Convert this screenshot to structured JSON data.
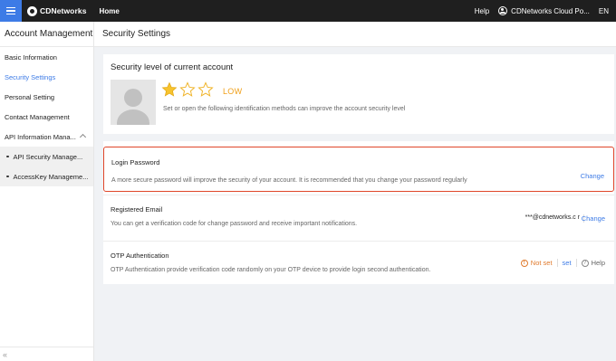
{
  "topbar": {
    "brand": "CDNetworks",
    "nav_home": "Home",
    "help": "Help",
    "user": "CDNetworks Cloud Po...",
    "lang": "EN"
  },
  "sidebar": {
    "title": "Account Management",
    "items": [
      {
        "label": "Basic Information",
        "active": false
      },
      {
        "label": "Security Settings",
        "active": true
      },
      {
        "label": "Personal Setting",
        "active": false
      },
      {
        "label": "Contact Management",
        "active": false
      }
    ],
    "group": {
      "label": "API Information Mana...",
      "expanded": true,
      "children": [
        {
          "label": "API Security Manage..."
        },
        {
          "label": "AccessKey Manageme..."
        }
      ]
    },
    "collapse_glyph": "«"
  },
  "page": {
    "title": "Security Settings"
  },
  "security_level": {
    "title": "Security level of current account",
    "stars_filled": 1,
    "stars_total": 3,
    "level": "LOW",
    "description": "Set or open the following identification methods can improve the account security level"
  },
  "methods": {
    "login_password": {
      "title": "Login Password",
      "description": "A more secure password will improve the security of your account. It is recommended that you change your password regularly",
      "action": "Change"
    },
    "registered_email": {
      "title": "Registered Email",
      "description": "You can get a verification code for change password and receive important notifications.",
      "value": "***@cdnetworks.c r",
      "action": "Change"
    },
    "otp": {
      "title": "OTP Authentication",
      "description": "OTP Authentication provide verification code randomly on your OTP device to provide login second authentication.",
      "status": "Not set",
      "action": "set",
      "help": "Help"
    }
  },
  "colors": {
    "accent": "#3d7be6",
    "topbar": "#1f1f1f",
    "warning": "#f0a01a",
    "highlight_border": "#e0462a"
  }
}
